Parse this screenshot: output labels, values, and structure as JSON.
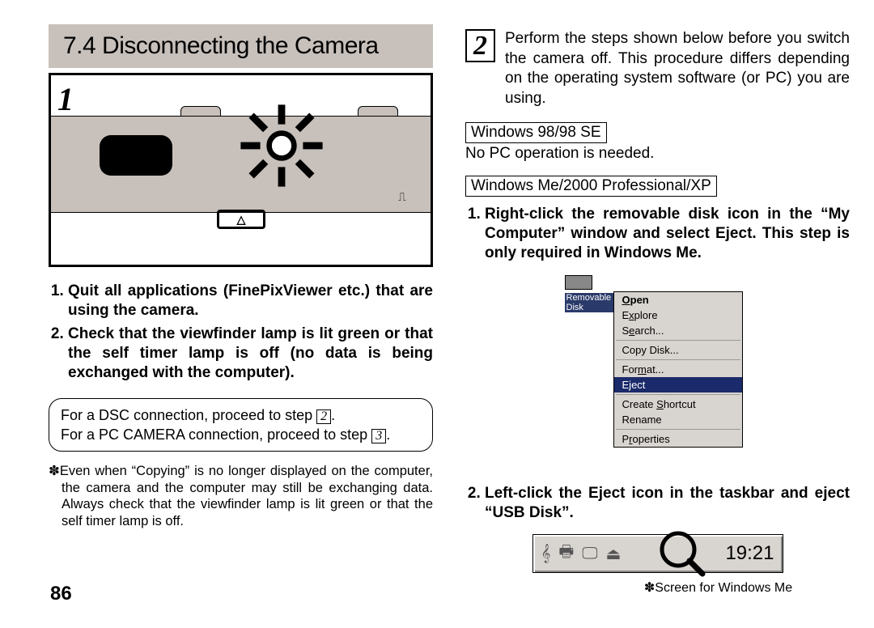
{
  "header": {
    "title": "7.4 Disconnecting the Camera"
  },
  "left": {
    "step_badge": "1",
    "steps": [
      "Quit all applications (FinePixViewer etc.) that are using the camera.",
      "Check that the viewfinder lamp is lit green or that the self timer lamp is off (no data is being exchanged with the computer)."
    ],
    "note_line1_a": "For a DSC connection, proceed to step ",
    "note_line1_num": "2",
    "note_line1_b": ".",
    "note_line2_a": "For a PC CAMERA connection, proceed to step ",
    "note_line2_num": "3",
    "note_line2_b": ".",
    "footnote": "✽Even when “Copying” is no longer displayed on the computer, the camera and the computer may still be exchanging data. Always check that the viewfinder lamp is lit green or that the self timer lamp is off."
  },
  "right": {
    "step_badge": "2",
    "intro": "Perform the steps shown below before you switch the camera off. This procedure differs depending on the operating system software (or PC) you are using.",
    "os1_label": "Windows 98/98 SE",
    "os1_note": "No PC operation is needed.",
    "os2_label": "Windows Me/2000 Professional/XP",
    "steps": [
      "Right-click the removable disk icon in the “My Computer” window and select Eject. This step is only required in Windows Me.",
      "Left-click the Eject icon in the taskbar and eject “USB Disk”."
    ],
    "disk_label_line1": "Removable",
    "disk_label_line2": "Disk",
    "menu": {
      "open": "Open",
      "explore": "Explore",
      "search": "Search...",
      "copy_disk": "Copy Disk...",
      "format": "Format...",
      "eject": "Eject",
      "create_shortcut": "Create Shortcut",
      "rename": "Rename",
      "properties": "Properties"
    },
    "clock": "19:21",
    "caption": "✽Screen for Windows Me"
  },
  "page_number": "86"
}
